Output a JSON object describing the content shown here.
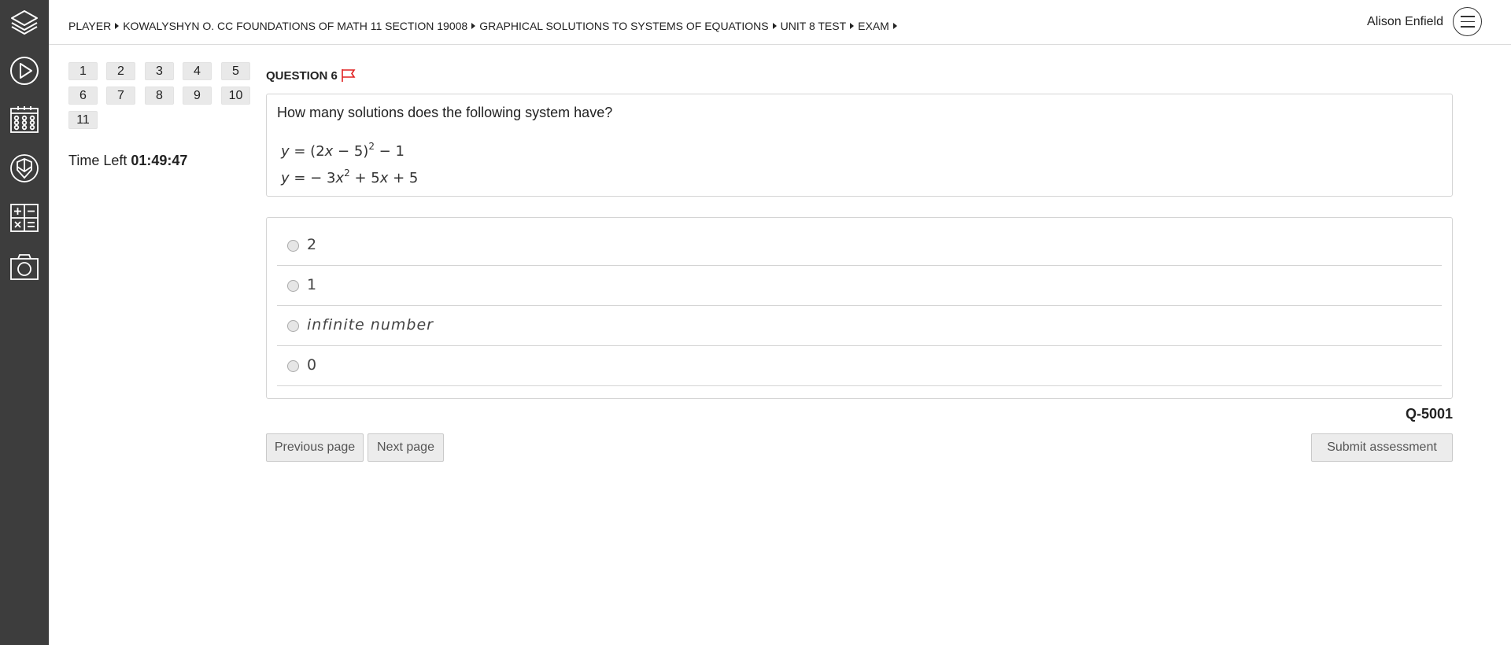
{
  "breadcrumb": [
    "PLAYER",
    "KOWALYSHYN O. CC FOUNDATIONS OF MATH 11 SECTION 19008",
    "GRAPHICAL SOLUTIONS TO SYSTEMS OF EQUATIONS",
    "UNIT 8 TEST",
    "EXAM"
  ],
  "user": {
    "name": "Alison Enfield"
  },
  "sidebar_icons": [
    "layers-icon",
    "play-icon",
    "calendar-icon",
    "gradebook-icon",
    "calculator-icon",
    "camera-icon"
  ],
  "question_nav": [
    "1",
    "2",
    "3",
    "4",
    "5",
    "6",
    "7",
    "8",
    "9",
    "10",
    "11"
  ],
  "timer": {
    "label": "Time Left",
    "value": "01:49:47"
  },
  "question": {
    "title": "QUESTION 6",
    "prompt": "How many solutions does the following system have?",
    "flag_color": "#e02020"
  },
  "options": [
    {
      "label": "2"
    },
    {
      "label": "1"
    },
    {
      "label": "infinite number"
    },
    {
      "label": "0"
    }
  ],
  "question_id": "Q-5001",
  "buttons": {
    "previous": "Previous page",
    "next": "Next page",
    "submit": "Submit assessment"
  },
  "colors": {
    "sidebar": "#3d3d3d",
    "accent_flag": "#e02020"
  }
}
